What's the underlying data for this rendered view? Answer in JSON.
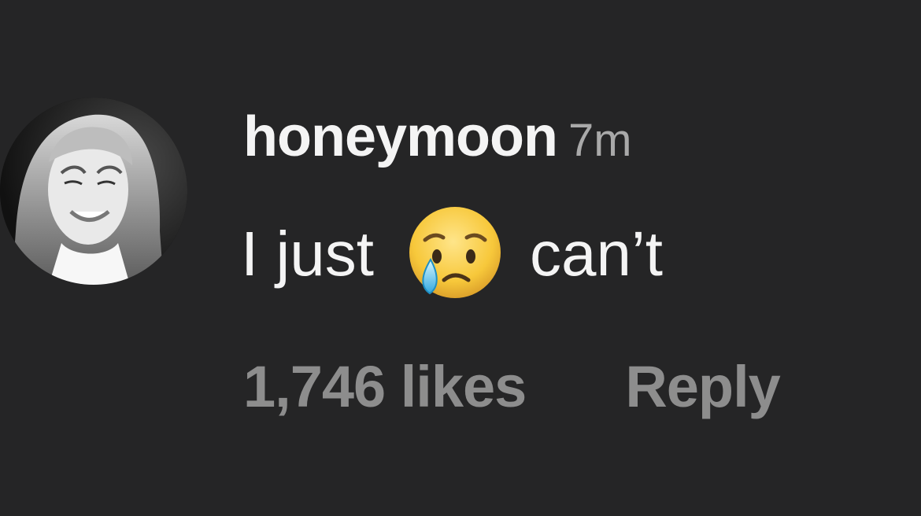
{
  "comment": {
    "username": "honeymoon",
    "timestamp": "7m",
    "text_before": "I just",
    "emoji": "crying-face",
    "text_after": "can’t",
    "likes": "1,746 likes",
    "reply_label": "Reply"
  },
  "colors": {
    "background": "#252526",
    "primary_text": "#f4f4f4",
    "secondary_text": "#a9a9a9",
    "action_text": "#8d8d8d"
  }
}
